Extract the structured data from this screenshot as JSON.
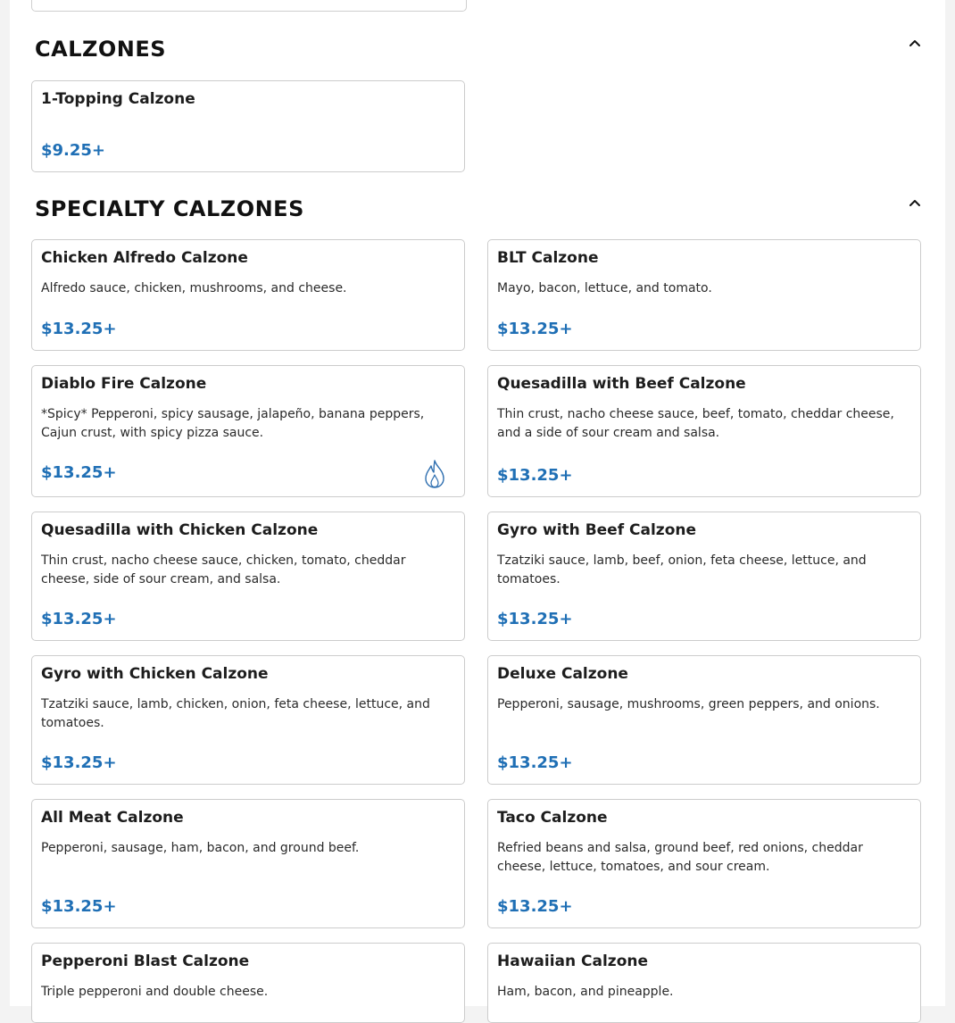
{
  "sections": {
    "calzones": {
      "title": "CALZONES",
      "items": [
        {
          "name": "1-Topping Calzone",
          "description": "",
          "price": "$9.25+"
        }
      ]
    },
    "specialty": {
      "title": "SPECIALTY CALZONES",
      "items": [
        {
          "name": "Chicken Alfredo Calzone",
          "description": "Alfredo sauce, chicken, mushrooms, and cheese.",
          "price": "$13.25+"
        },
        {
          "name": "BLT Calzone",
          "description": "Mayo, bacon, lettuce, and tomato.",
          "price": "$13.25+"
        },
        {
          "name": "Diablo Fire Calzone",
          "description": "*Spicy* Pepperoni, spicy sausage, jalapeño, banana peppers, Cajun crust, with spicy pizza sauce.",
          "price": "$13.25+",
          "icon": "spicy-flame-icon"
        },
        {
          "name": "Quesadilla with Beef Calzone",
          "description": "Thin crust, nacho cheese sauce, beef, tomato, cheddar cheese, and a side of sour cream and salsa.",
          "price": "$13.25+"
        },
        {
          "name": "Quesadilla with Chicken Calzone",
          "description": "Thin crust, nacho cheese sauce, chicken, tomato, cheddar cheese, side of sour cream, and salsa.",
          "price": "$13.25+"
        },
        {
          "name": "Gyro with Beef Calzone",
          "description": "Tzatziki sauce, lamb, beef, onion, feta cheese, lettuce, and tomatoes.",
          "price": "$13.25+"
        },
        {
          "name": "Gyro with Chicken Calzone",
          "description": "Tzatziki sauce, lamb, chicken, onion, feta cheese, lettuce, and tomatoes.",
          "price": "$13.25+"
        },
        {
          "name": "Deluxe Calzone",
          "description": "Pepperoni, sausage, mushrooms, green peppers, and onions.",
          "price": "$13.25+"
        },
        {
          "name": "All Meat Calzone",
          "description": "Pepperoni, sausage, ham, bacon, and ground beef.",
          "price": "$13.25+"
        },
        {
          "name": "Taco Calzone",
          "description": "Refried beans and salsa, ground beef, red onions, cheddar cheese, lettuce, tomatoes, and sour cream.",
          "price": "$13.25+"
        },
        {
          "name": "Pepperoni Blast Calzone",
          "description": "Triple pepperoni and double cheese.",
          "price": ""
        },
        {
          "name": "Hawaiian Calzone",
          "description": "Ham, bacon, and pineapple.",
          "price": ""
        }
      ]
    }
  },
  "icons": {
    "collapse": "chevron-up-icon",
    "spicy": "spicy-flame-icon"
  },
  "colors": {
    "price": "#1f6fb5",
    "border": "#cccccc"
  }
}
